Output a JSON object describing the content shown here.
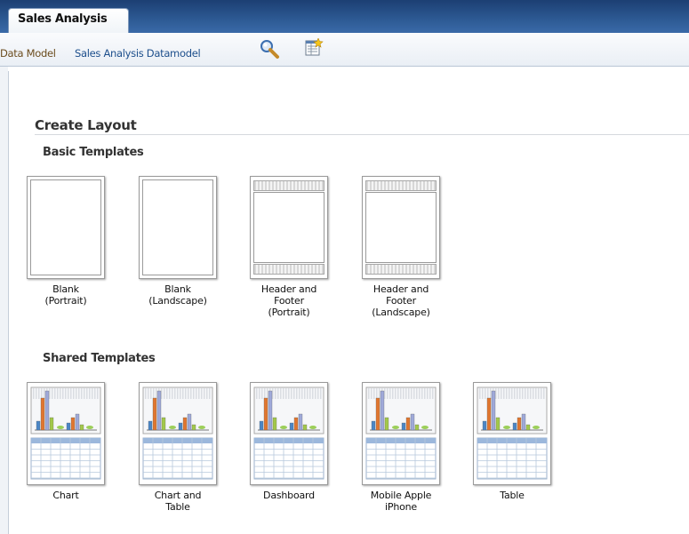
{
  "tab": {
    "label": "Sales Analysis"
  },
  "data_model": {
    "label": "Data Model",
    "value": "Sales Analysis Datamodel"
  },
  "content": {
    "title": "Create Layout",
    "basic_title": "Basic Templates",
    "basic": [
      {
        "line1": "Blank",
        "line2": "(Portrait)",
        "line3": ""
      },
      {
        "line1": "Blank",
        "line2": "(Landscape)",
        "line3": ""
      },
      {
        "line1": "Header and",
        "line2": "Footer",
        "line3": "(Portrait)"
      },
      {
        "line1": "Header and",
        "line2": "Footer",
        "line3": "(Landscape)"
      }
    ],
    "shared_title": "Shared Templates",
    "shared": [
      {
        "line1": "Chart",
        "line2": ""
      },
      {
        "line1": "Chart and",
        "line2": "Table"
      },
      {
        "line1": "Dashboard",
        "line2": ""
      },
      {
        "line1": "Mobile Apple",
        "line2": "iPhone"
      },
      {
        "line1": "Table",
        "line2": ""
      }
    ]
  },
  "colors": {
    "topbar": "#1c3f73",
    "link": "#1d4f8c",
    "label": "#6b4c1e"
  },
  "icons": [
    "search-icon",
    "new-datamodel-icon"
  ]
}
